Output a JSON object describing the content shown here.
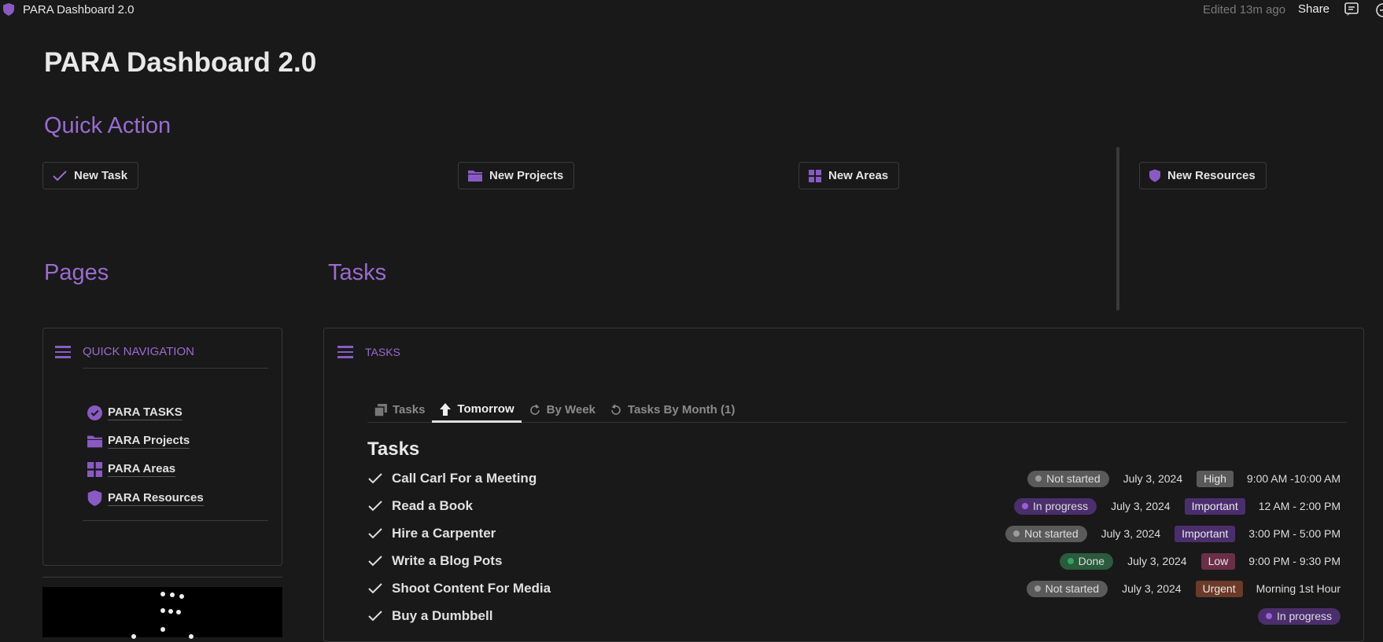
{
  "topbar": {
    "title": "PARA Dashboard 2.0",
    "edited": "Edited 13m ago",
    "share": "Share"
  },
  "page_title": "PARA Dashboard 2.0",
  "quick_action": {
    "heading": "Quick Action",
    "buttons": [
      "New Task",
      "New Projects",
      "New Areas",
      "New Resources"
    ]
  },
  "pages": {
    "heading": "Pages",
    "card_title": "QUICK NAVIGATION",
    "items": [
      "PARA TASKS",
      "PARA Projects",
      "PARA Areas",
      "PARA Resources"
    ]
  },
  "tasks": {
    "heading": "Tasks",
    "card_title": "TASKS",
    "tabs": [
      "Tasks",
      "Tomorrow",
      "By Week",
      "Tasks By Month (1)"
    ],
    "active_tab": "Tomorrow",
    "list_title": "Tasks",
    "rows": [
      {
        "name": "Call Carl For a Meeting",
        "status": "Not started",
        "date": "July 3, 2024",
        "priority": "High",
        "time": "9:00 AM -10:00 AM"
      },
      {
        "name": "Read a Book",
        "status": "In progress",
        "date": "July 3, 2024",
        "priority": "Important",
        "time": "12 AM - 2:00 PM"
      },
      {
        "name": "Hire a Carpenter",
        "status": "Not started",
        "date": "July 3, 2024",
        "priority": "Important",
        "time": "3:00 PM - 5:00 PM"
      },
      {
        "name": "Write a Blog Pots",
        "status": "Done",
        "date": "July 3, 2024",
        "priority": "Low",
        "time": "9:00 PM - 9:30 PM"
      },
      {
        "name": "Shoot Content For Media",
        "status": "Not started",
        "date": "July 3, 2024",
        "priority": "Urgent",
        "time": "Morning 1st Hour"
      },
      {
        "name": "Buy a Dumbbell",
        "status": "In progress"
      }
    ]
  },
  "colors": {
    "accent": "#9a6bd0",
    "status": {
      "Not started": "#5a5a5a",
      "In progress": "#4b2e6e",
      "Done": "#2b5a3c"
    },
    "status_dot": {
      "Not started": "#9b9b9b",
      "In progress": "#9b5fd4",
      "Done": "#2ea661"
    },
    "priority": {
      "High": "#5a5a5a",
      "Important": "#4b2e6e",
      "Low": "#6a2f47",
      "Urgent": "#6b3a28"
    }
  }
}
